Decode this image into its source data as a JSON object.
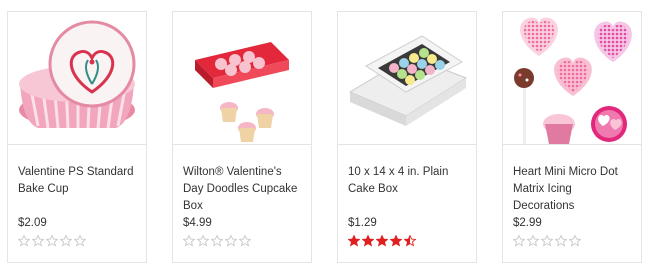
{
  "products": [
    {
      "name": "Valentine PS Standard Bake Cup",
      "price": "$2.09",
      "rating": 0,
      "image_icon": "bake-cup-icon"
    },
    {
      "name": "Wilton® Valentine's Day Doodles Cupcake Box",
      "price": "$4.99",
      "rating": 0,
      "image_icon": "cupcake-box-icon"
    },
    {
      "name": "10 x 14 x 4 in. Plain Cake Box",
      "price": "$1.29",
      "rating": 4.5,
      "image_icon": "cake-box-icon"
    },
    {
      "name": "Heart Mini Micro Dot Matrix Icing Decorations",
      "price": "$2.99",
      "rating": 0,
      "image_icon": "icing-decorations-icon"
    }
  ],
  "colors": {
    "star_filled": "#e02020",
    "star_empty": "#c8c8c8",
    "card_border": "#e4e4e4"
  }
}
